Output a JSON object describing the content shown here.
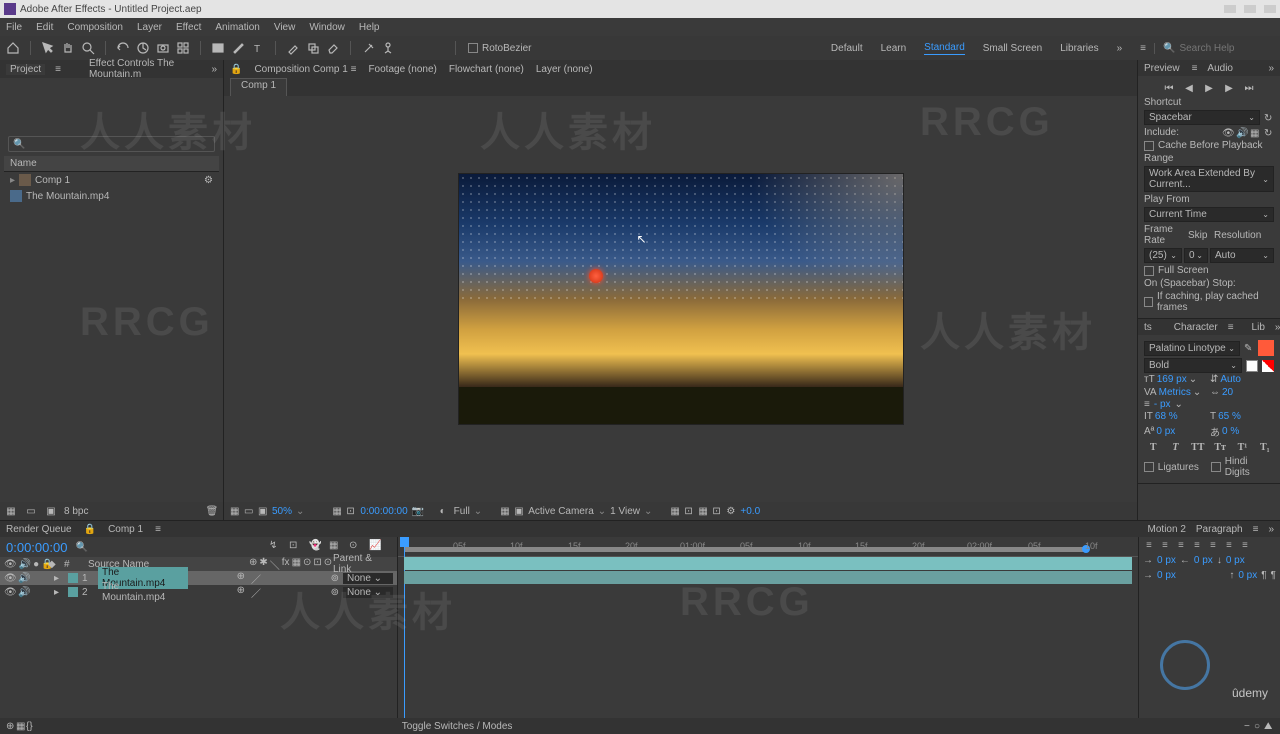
{
  "title": "Adobe After Effects - Untitled Project.aep",
  "menu": [
    "File",
    "Edit",
    "Composition",
    "Layer",
    "Effect",
    "Animation",
    "View",
    "Window",
    "Help"
  ],
  "toolbar": {
    "rotobezier": "RotoBezier"
  },
  "workspaces": {
    "default": "Default",
    "learn": "Learn",
    "standard": "Standard",
    "small": "Small Screen",
    "libraries": "Libraries"
  },
  "search": {
    "placeholder": "Search Help"
  },
  "project": {
    "tab": "Project",
    "effect_tab": "Effect Controls The Mountain.m",
    "name_col": "Name",
    "items": [
      {
        "name": "Comp 1",
        "type": "comp"
      },
      {
        "name": "The Mountain.mp4",
        "type": "file"
      }
    ],
    "bpc": "8 bpc"
  },
  "comp": {
    "tabs": {
      "composition": "Composition Comp 1",
      "footage": "Footage (none)",
      "flowchart": "Flowchart (none)",
      "layer": "Layer (none)"
    },
    "subtab": "Comp 1",
    "footer": {
      "zoom": "50%",
      "time": "0:00:00:00",
      "res": "Full",
      "camera": "Active Camera",
      "view": "1 View",
      "exposure": "+0.0"
    }
  },
  "preview": {
    "tab1": "Preview",
    "tab2": "Audio",
    "shortcut_label": "Shortcut",
    "shortcut": "Spacebar",
    "include": "Include:",
    "cache": "Cache Before Playback",
    "range_label": "Range",
    "range": "Work Area Extended By Current...",
    "playfrom_label": "Play From",
    "playfrom": "Current Time",
    "framerate_label": "Frame Rate",
    "skip_label": "Skip",
    "resolution_label": "Resolution",
    "fps": "(25)",
    "skip": "0",
    "res": "Auto",
    "fullscreen": "Full Screen",
    "onstop": "On (Spacebar) Stop:",
    "ifcaching": "If caching, play cached frames"
  },
  "character": {
    "tab1": "Character",
    "tab2": "Lib",
    "side": "ts",
    "font": "Palatino Linotype",
    "style": "Bold",
    "size": "169 px",
    "leading": "Auto",
    "kerning": "Metrics",
    "tracking": "20",
    "stroke": "- px",
    "vscale": "68 %",
    "hscale": "65 %",
    "baseline": "0 px",
    "tsume": "0 %",
    "ligatures": "Ligatures",
    "hindi": "Hindi Digits"
  },
  "paragraph": {
    "tab1": "Motion 2",
    "tab2": "Paragraph",
    "px": "0 px"
  },
  "timeline": {
    "render_tab": "Render Queue",
    "comp_tab": "Comp 1",
    "time": "0:00:00:00",
    "cols": {
      "source": "Source Name",
      "parent": "Parent & Link"
    },
    "layers": [
      {
        "num": "1",
        "name": "The Mountain.mp4",
        "parent": "None",
        "selected": true
      },
      {
        "num": "2",
        "name": "The Mountain.mp4",
        "parent": "None",
        "selected": false
      }
    ],
    "ruler": [
      "05f",
      "10f",
      "15f",
      "20f",
      "01:00f",
      "05f",
      "10f",
      "15f",
      "20f",
      "02:00f",
      "05f",
      "10f"
    ]
  },
  "statusbar": {
    "toggle": "Toggle Switches / Modes"
  }
}
